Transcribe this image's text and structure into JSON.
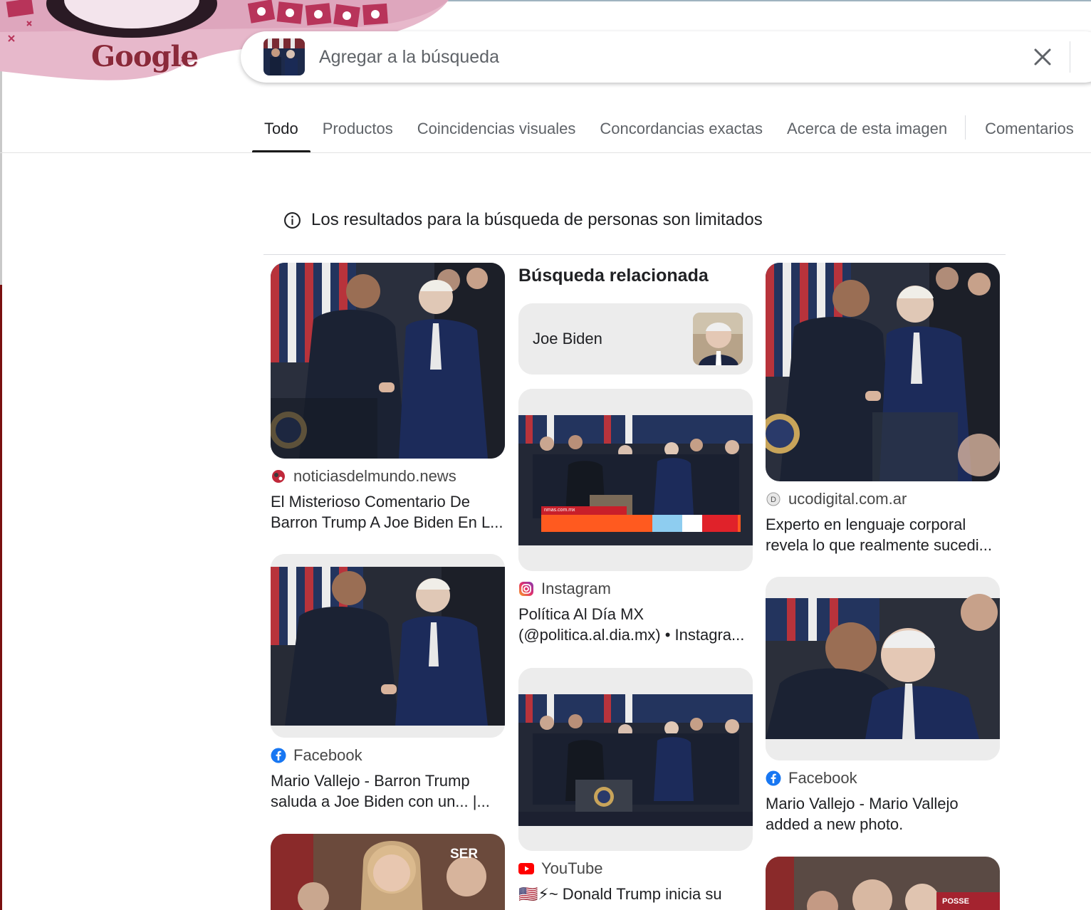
{
  "doodle": {
    "logo_text": "Google"
  },
  "search": {
    "placeholder": "Agregar a la búsqueda"
  },
  "tabs": [
    {
      "label": "Todo",
      "active": true
    },
    {
      "label": "Productos"
    },
    {
      "label": "Coincidencias visuales"
    },
    {
      "label": "Concordancias exactas"
    },
    {
      "label": "Acerca de esta imagen"
    },
    {
      "label": "Comentarios"
    }
  ],
  "notice": {
    "text": "Los resultados para la búsqueda de personas son limitados"
  },
  "related": {
    "heading": "Búsqueda relacionada",
    "chip_label": "Joe Biden"
  },
  "results": {
    "r1": {
      "source": "noticiasdelmundo.news",
      "title_line1": "El Misterioso Comentario De",
      "title_line2": "Barron Trump A Joe Biden En L..."
    },
    "r2": {
      "source": "ucodigital.com.ar",
      "title_line1": "Experto en lenguaje corporal",
      "title_line2": "revela lo que realmente sucedi..."
    },
    "r3": {
      "source": "Instagram",
      "title_line1": "Política Al Día MX",
      "title_line2": "(@politica.al.dia.mx) • Instagra..."
    },
    "r4": {
      "source": "Facebook",
      "title_line1": "Mario Vallejo - Barron Trump",
      "title_line2": "saluda a Joe Biden con un... |..."
    },
    "r5": {
      "source": "Facebook",
      "title_line1": "Mario Vallejo - Mario Vallejo",
      "title_line2": "added a new photo."
    },
    "r6": {
      "source": "YouTube",
      "title_line1": "🇺🇸⚡~ Donald Trump inicia su"
    }
  },
  "image_labels": {
    "nmas": "nmas.com.mx",
    "ser": "SER",
    "posse": "POSSE"
  },
  "colors": {
    "accent": "#1a1a1a",
    "muted": "#5f6368",
    "chip_bg": "#ececec",
    "facebook": "#1877f2",
    "youtube": "#ff0000"
  }
}
